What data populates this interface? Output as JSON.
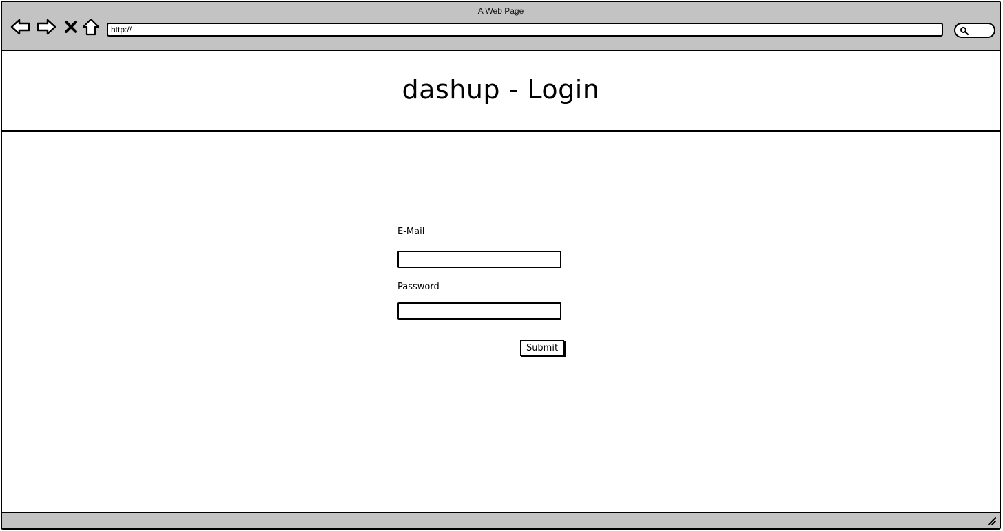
{
  "window": {
    "title": "A Web Page"
  },
  "toolbar": {
    "back_icon": "arrow-left-icon",
    "forward_icon": "arrow-right-icon",
    "stop_icon": "close-icon",
    "home_icon": "home-icon",
    "search_icon": "search-icon"
  },
  "address_bar": {
    "value": "http://"
  },
  "page": {
    "title": "dashup - Login"
  },
  "login_form": {
    "email_label": "E-Mail",
    "email_value": "",
    "password_label": "Password",
    "password_value": "",
    "submit_label": "Submit"
  }
}
